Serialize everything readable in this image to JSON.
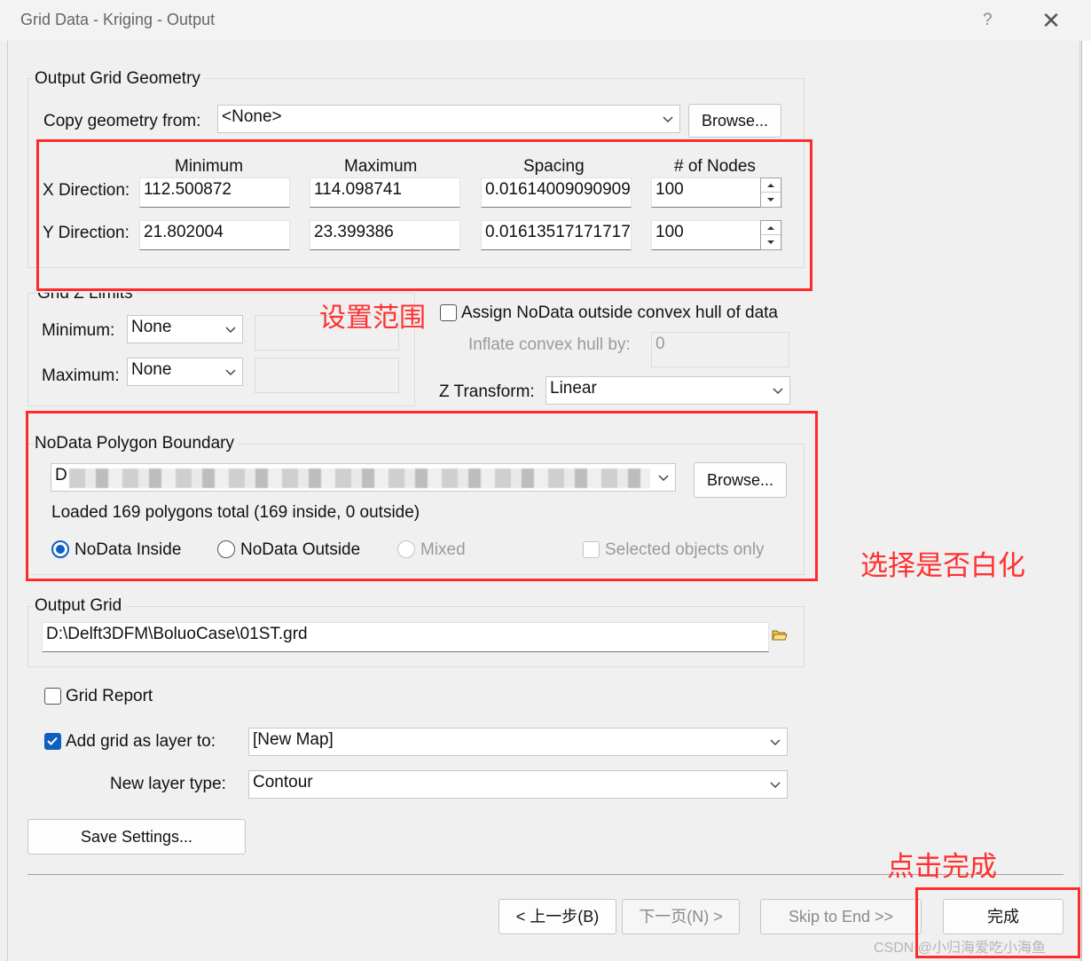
{
  "window": {
    "title": "Grid Data - Kriging - Output",
    "help": "?",
    "close": "✕"
  },
  "geometry": {
    "group_label": "Output Grid Geometry",
    "copy_label": "Copy geometry from:",
    "copy_value": "<None>",
    "browse_label": "Browse...",
    "headers": {
      "min": "Minimum",
      "max": "Maximum",
      "spacing": "Spacing",
      "nodes": "# of Nodes"
    },
    "x": {
      "label": "X Direction:",
      "min": "112.500872",
      "max": "114.098741",
      "spacing": "0.01614009090909",
      "nodes": "100"
    },
    "y": {
      "label": "Y Direction:",
      "min": "21.802004",
      "max": "23.399386",
      "spacing": "0.01613517171717",
      "nodes": "100"
    }
  },
  "zlimits": {
    "group_label": "Grid Z Limits",
    "min_label": "Minimum:",
    "min_value": "None",
    "max_label": "Maximum:",
    "max_value": "None"
  },
  "convex": {
    "assign_label": "Assign NoData outside convex hull of data",
    "inflate_label": "Inflate convex hull by:",
    "inflate_value": "0",
    "ztransform_label": "Z Transform:",
    "ztransform_value": "Linear"
  },
  "nodata": {
    "group_label": "NoData Polygon Boundary",
    "path_prefix": "D",
    "browse_label": "Browse...",
    "status": "Loaded 169 polygons total (169 inside, 0 outside)",
    "opt_inside": "NoData Inside",
    "opt_outside": "NoData Outside",
    "opt_mixed": "Mixed",
    "selected_only": "Selected objects only"
  },
  "output": {
    "group_label": "Output Grid",
    "path": "D:\\Delft3DFM\\BoluoCase\\01ST.grd"
  },
  "report": {
    "label": "Grid Report"
  },
  "layer": {
    "add_label": "Add grid as layer to:",
    "add_value": "[New Map]",
    "type_label": "New layer type:",
    "type_value": "Contour"
  },
  "buttons": {
    "save": "Save Settings...",
    "back": "< 上一步(B)",
    "next": "下一页(N) >",
    "skip": "Skip to End >>",
    "finish": "完成"
  },
  "annotations": {
    "range": "设置范围",
    "whiten": "选择是否白化",
    "finish": "点击完成",
    "watermark": "CSDN @小归海爱吃小海鱼"
  },
  "colors": {
    "accent": "#0f5fbf",
    "annotation": "#ff2a2a"
  }
}
